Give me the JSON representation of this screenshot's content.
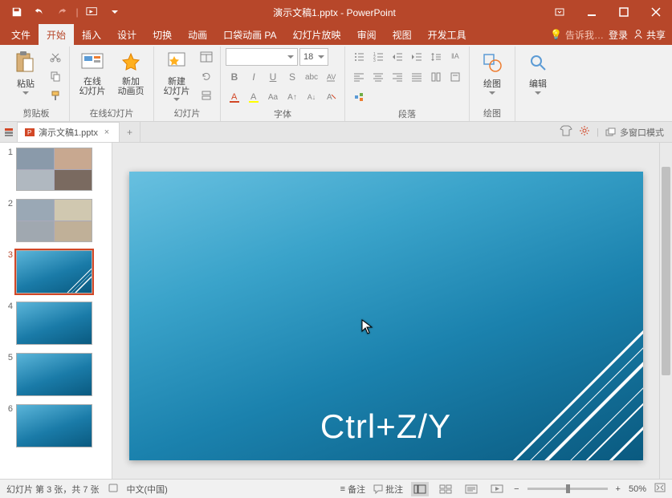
{
  "app": {
    "title": "演示文稿1.pptx - PowerPoint"
  },
  "menu": {
    "file": "文件",
    "home": "开始",
    "insert": "插入",
    "design": "设计",
    "transition": "切换",
    "animation": "动画",
    "pocket": "口袋动画 PA",
    "slideshow": "幻灯片放映",
    "review": "审阅",
    "view": "视图",
    "dev": "开发工具",
    "tellme": "告诉我…",
    "login": "登录",
    "share": "共享"
  },
  "ribbon": {
    "clipboard": {
      "label": "剪贴板",
      "paste": "粘贴"
    },
    "onlineSlides": {
      "online": "在线\n幻灯片",
      "newAnim": "新加\n动画页",
      "label": "在线幻灯片"
    },
    "slides": {
      "newSlide": "新建\n幻灯片",
      "label": "幻灯片"
    },
    "font": {
      "label": "字体",
      "size": "18"
    },
    "paragraph": {
      "label": "段落"
    },
    "drawing": {
      "label": "绘图",
      "btn": "绘图"
    },
    "editing": {
      "btn": "编辑"
    }
  },
  "docTab": {
    "name": "演示文稿1.pptx"
  },
  "docTabsRight": {
    "multi": "多窗口模式"
  },
  "thumbs": [
    1,
    2,
    3,
    4,
    5,
    6
  ],
  "selectedThumb": 3,
  "slide": {
    "text": "Ctrl+Z/Y"
  },
  "status": {
    "slideInfo": "幻灯片 第 3 张，共 7 张",
    "lang": "中文(中国)",
    "notes": "备注",
    "comments": "批注",
    "zoom": "50%"
  }
}
